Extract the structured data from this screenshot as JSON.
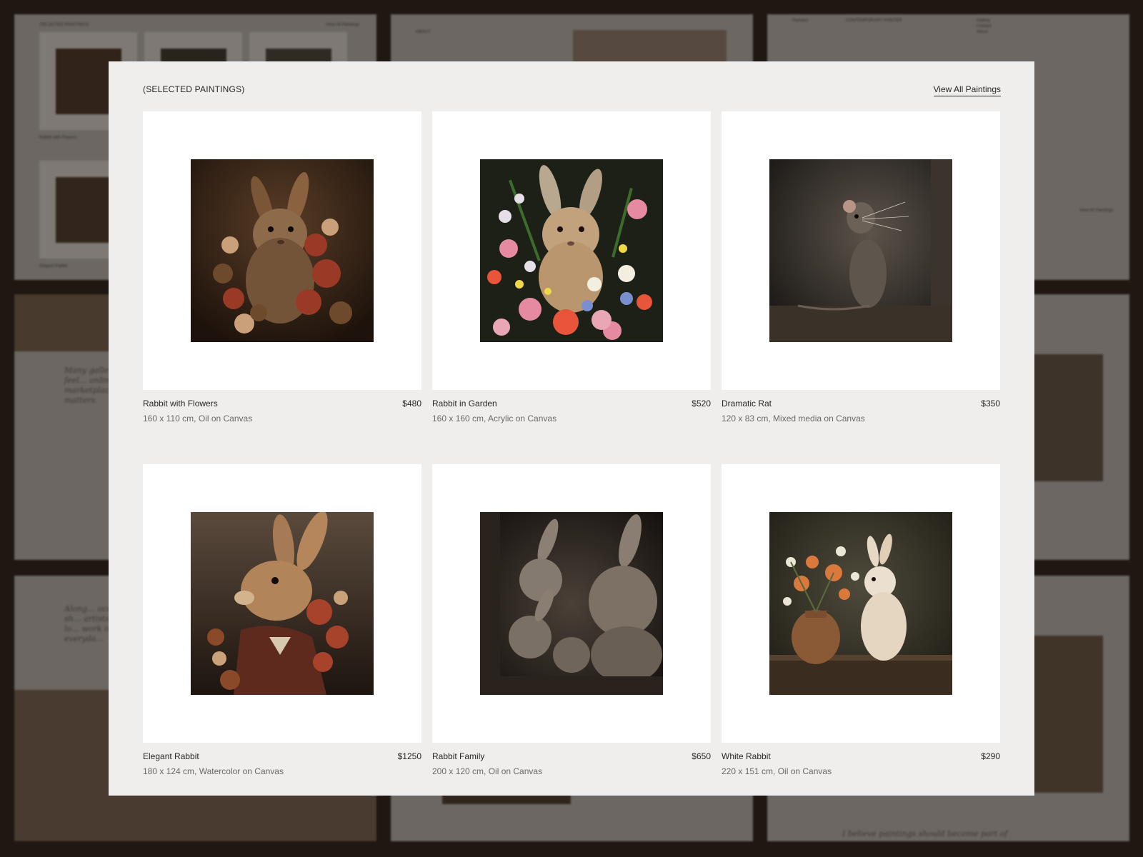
{
  "section": {
    "label": "(SELECTED PAINTINGS)",
    "view_all": "View All Paintings"
  },
  "paintings": [
    {
      "title": "Rabbit with Flowers",
      "price": "$480",
      "details": "160 x 110 cm, Oil on Canvas"
    },
    {
      "title": "Rabbit in Garden",
      "price": "$520",
      "details": "160 x 160 cm, Acrylic on Canvas"
    },
    {
      "title": "Dramatic Rat",
      "price": "$350",
      "details": "120 x 83 cm, Mixed media on Canvas"
    },
    {
      "title": "Elegant Rabbit",
      "price": "$1250",
      "details": "180 x 124 cm, Watercolor on Canvas"
    },
    {
      "title": "Rabbit Family",
      "price": "$650",
      "details": "200 x 120 cm, Oil on Canvas"
    },
    {
      "title": "White Rabbit",
      "price": "$290",
      "details": "220 x 151 cm, Oil on Canvas"
    }
  ],
  "background_pages": {
    "p1_header": "(SELECTED PAINTINGS)",
    "p1_link": "View All Paintings",
    "p1_item1": "Rabbit with Flowers",
    "p1_item2": "Elegant Rabbit",
    "p2_label": "ABOUT",
    "p3_nav1": "Humanz",
    "p3_nav2": "CONTEMPORARY PAINTER",
    "p3_menu1": "Gallery",
    "p3_menu2": "Contact",
    "p3_menu3": "About",
    "p3_link": "View All Paintings",
    "p4_quote": "Many galleries can feel… online marketplace… why it matters.",
    "p5_quote": "Along… occasionally sh… artists. These lo… work in everyda…",
    "p6_quote": "I believe paintings should become part of"
  },
  "colors": {
    "modal_bg": "#efeeec",
    "frame_bg": "#ffffff",
    "text_primary": "#2a2624",
    "text_secondary": "#6d6966",
    "page_backdrop": "#241a14"
  }
}
